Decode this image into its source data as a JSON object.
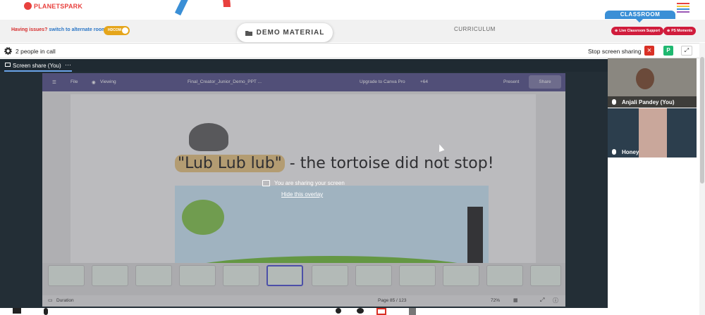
{
  "header": {
    "logo_text": "PLANETSPARK",
    "issues_text": "Having issues?",
    "issues_link": "switch to alternate room",
    "toggle_label": "HDCOM",
    "demo_material": "DEMO MATERIAL",
    "curriculum": "CURRICULUM",
    "classroom": "CLASSROOM",
    "live_support": "Live Classroom Support",
    "ps_moments": "PS Moments",
    "colors": {
      "brand_red": "#e8413e",
      "classroom_blue": "#3a8fd6",
      "pill_red": "#d01c3c"
    }
  },
  "meet": {
    "people_count": "2 people in call",
    "stop_sharing": "Stop screen sharing",
    "avatar_letter": "P",
    "share_tab": "Screen share (You)"
  },
  "canva": {
    "file": "File",
    "viewing": "Viewing",
    "doc_title": "Final_Creator_Junior_Demo_PPT ...",
    "upgrade": "Upgrade to Canva Pro",
    "plus_count": "+64",
    "present": "Present",
    "share": "Share",
    "slide_title_highlight": "\"Lub Lub lub\"",
    "slide_title_rest": " - the tortoise did not stop!",
    "duration": "Duration",
    "page": "Page 85 / 123",
    "zoom": "72%"
  },
  "overlay": {
    "message": "You are sharing your screen",
    "hide": "Hide this overlay"
  },
  "participants": [
    {
      "name": "Anjali Pandey (You)"
    },
    {
      "name": "Honey"
    }
  ]
}
